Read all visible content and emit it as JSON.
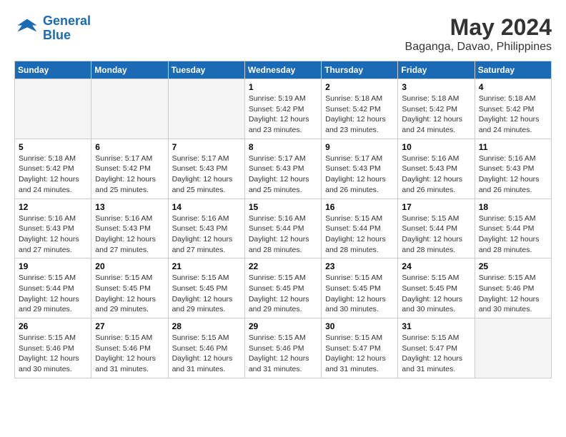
{
  "logo": {
    "text_general": "General",
    "text_blue": "Blue"
  },
  "title": "May 2024",
  "location": "Baganga, Davao, Philippines",
  "days_of_week": [
    "Sunday",
    "Monday",
    "Tuesday",
    "Wednesday",
    "Thursday",
    "Friday",
    "Saturday"
  ],
  "weeks": [
    [
      {
        "day": "",
        "info": ""
      },
      {
        "day": "",
        "info": ""
      },
      {
        "day": "",
        "info": ""
      },
      {
        "day": "1",
        "sunrise": "5:19 AM",
        "sunset": "5:42 PM",
        "daylight": "12 hours and 23 minutes."
      },
      {
        "day": "2",
        "sunrise": "5:18 AM",
        "sunset": "5:42 PM",
        "daylight": "12 hours and 23 minutes."
      },
      {
        "day": "3",
        "sunrise": "5:18 AM",
        "sunset": "5:42 PM",
        "daylight": "12 hours and 24 minutes."
      },
      {
        "day": "4",
        "sunrise": "5:18 AM",
        "sunset": "5:42 PM",
        "daylight": "12 hours and 24 minutes."
      }
    ],
    [
      {
        "day": "5",
        "sunrise": "5:18 AM",
        "sunset": "5:42 PM",
        "daylight": "12 hours and 24 minutes."
      },
      {
        "day": "6",
        "sunrise": "5:17 AM",
        "sunset": "5:42 PM",
        "daylight": "12 hours and 25 minutes."
      },
      {
        "day": "7",
        "sunrise": "5:17 AM",
        "sunset": "5:43 PM",
        "daylight": "12 hours and 25 minutes."
      },
      {
        "day": "8",
        "sunrise": "5:17 AM",
        "sunset": "5:43 PM",
        "daylight": "12 hours and 25 minutes."
      },
      {
        "day": "9",
        "sunrise": "5:17 AM",
        "sunset": "5:43 PM",
        "daylight": "12 hours and 26 minutes."
      },
      {
        "day": "10",
        "sunrise": "5:16 AM",
        "sunset": "5:43 PM",
        "daylight": "12 hours and 26 minutes."
      },
      {
        "day": "11",
        "sunrise": "5:16 AM",
        "sunset": "5:43 PM",
        "daylight": "12 hours and 26 minutes."
      }
    ],
    [
      {
        "day": "12",
        "sunrise": "5:16 AM",
        "sunset": "5:43 PM",
        "daylight": "12 hours and 27 minutes."
      },
      {
        "day": "13",
        "sunrise": "5:16 AM",
        "sunset": "5:43 PM",
        "daylight": "12 hours and 27 minutes."
      },
      {
        "day": "14",
        "sunrise": "5:16 AM",
        "sunset": "5:43 PM",
        "daylight": "12 hours and 27 minutes."
      },
      {
        "day": "15",
        "sunrise": "5:16 AM",
        "sunset": "5:44 PM",
        "daylight": "12 hours and 28 minutes."
      },
      {
        "day": "16",
        "sunrise": "5:15 AM",
        "sunset": "5:44 PM",
        "daylight": "12 hours and 28 minutes."
      },
      {
        "day": "17",
        "sunrise": "5:15 AM",
        "sunset": "5:44 PM",
        "daylight": "12 hours and 28 minutes."
      },
      {
        "day": "18",
        "sunrise": "5:15 AM",
        "sunset": "5:44 PM",
        "daylight": "12 hours and 28 minutes."
      }
    ],
    [
      {
        "day": "19",
        "sunrise": "5:15 AM",
        "sunset": "5:44 PM",
        "daylight": "12 hours and 29 minutes."
      },
      {
        "day": "20",
        "sunrise": "5:15 AM",
        "sunset": "5:45 PM",
        "daylight": "12 hours and 29 minutes."
      },
      {
        "day": "21",
        "sunrise": "5:15 AM",
        "sunset": "5:45 PM",
        "daylight": "12 hours and 29 minutes."
      },
      {
        "day": "22",
        "sunrise": "5:15 AM",
        "sunset": "5:45 PM",
        "daylight": "12 hours and 29 minutes."
      },
      {
        "day": "23",
        "sunrise": "5:15 AM",
        "sunset": "5:45 PM",
        "daylight": "12 hours and 30 minutes."
      },
      {
        "day": "24",
        "sunrise": "5:15 AM",
        "sunset": "5:45 PM",
        "daylight": "12 hours and 30 minutes."
      },
      {
        "day": "25",
        "sunrise": "5:15 AM",
        "sunset": "5:46 PM",
        "daylight": "12 hours and 30 minutes."
      }
    ],
    [
      {
        "day": "26",
        "sunrise": "5:15 AM",
        "sunset": "5:46 PM",
        "daylight": "12 hours and 30 minutes."
      },
      {
        "day": "27",
        "sunrise": "5:15 AM",
        "sunset": "5:46 PM",
        "daylight": "12 hours and 31 minutes."
      },
      {
        "day": "28",
        "sunrise": "5:15 AM",
        "sunset": "5:46 PM",
        "daylight": "12 hours and 31 minutes."
      },
      {
        "day": "29",
        "sunrise": "5:15 AM",
        "sunset": "5:46 PM",
        "daylight": "12 hours and 31 minutes."
      },
      {
        "day": "30",
        "sunrise": "5:15 AM",
        "sunset": "5:47 PM",
        "daylight": "12 hours and 31 minutes."
      },
      {
        "day": "31",
        "sunrise": "5:15 AM",
        "sunset": "5:47 PM",
        "daylight": "12 hours and 31 minutes."
      },
      {
        "day": "",
        "info": ""
      }
    ]
  ]
}
